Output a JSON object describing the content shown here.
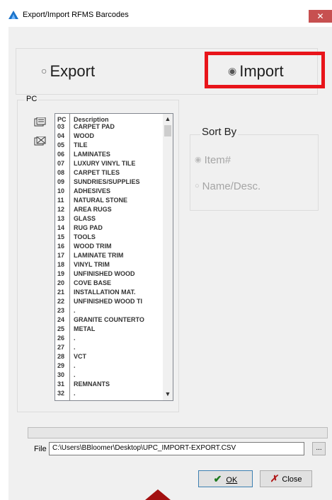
{
  "window": {
    "title": "Export/Import RFMS Barcodes",
    "close_glyph": "✕"
  },
  "mode": {
    "export_label": "Export",
    "import_label": "Import",
    "selected": "Import"
  },
  "pc_group": {
    "label": "PC",
    "header_code": "PC",
    "header_desc": "Description",
    "rows": [
      {
        "code": "03",
        "desc": "CARPET PAD"
      },
      {
        "code": "04",
        "desc": "WOOD"
      },
      {
        "code": "05",
        "desc": "TILE"
      },
      {
        "code": "06",
        "desc": "LAMINATES"
      },
      {
        "code": "07",
        "desc": "LUXURY VINYL TILE"
      },
      {
        "code": "08",
        "desc": "CARPET TILES"
      },
      {
        "code": "09",
        "desc": "SUNDRIES/SUPPLIES"
      },
      {
        "code": "10",
        "desc": "ADHESIVES"
      },
      {
        "code": "11",
        "desc": "NATURAL STONE"
      },
      {
        "code": "12",
        "desc": "AREA RUGS"
      },
      {
        "code": "13",
        "desc": "GLASS"
      },
      {
        "code": "14",
        "desc": "RUG PAD"
      },
      {
        "code": "15",
        "desc": "TOOLS"
      },
      {
        "code": "16",
        "desc": "WOOD TRIM"
      },
      {
        "code": "17",
        "desc": "LAMINATE TRIM"
      },
      {
        "code": "18",
        "desc": "VINYL TRIM"
      },
      {
        "code": "19",
        "desc": "UNFINISHED WOOD"
      },
      {
        "code": "20",
        "desc": "COVE BASE"
      },
      {
        "code": "21",
        "desc": "INSTALLATION MAT."
      },
      {
        "code": "22",
        "desc": "UNFINISHED WOOD TI"
      },
      {
        "code": "23",
        "desc": "."
      },
      {
        "code": "24",
        "desc": "GRANITE COUNTERTO"
      },
      {
        "code": "25",
        "desc": "METAL"
      },
      {
        "code": "26",
        "desc": "."
      },
      {
        "code": "27",
        "desc": "."
      },
      {
        "code": "28",
        "desc": "VCT"
      },
      {
        "code": "29",
        "desc": "."
      },
      {
        "code": "30",
        "desc": "."
      },
      {
        "code": "31",
        "desc": "REMNANTS"
      },
      {
        "code": "32",
        "desc": "."
      }
    ],
    "scroll_up": "▲",
    "scroll_down": "▼"
  },
  "sort_by": {
    "title": "Sort By",
    "option_item": "Item#",
    "option_name": "Name/Desc.",
    "selected": "Item#"
  },
  "file": {
    "label": "File",
    "path": "C:\\Users\\BBloomer\\Desktop\\UPC_IMPORT-EXPORT.CSV",
    "browse_label": "..."
  },
  "buttons": {
    "ok_label": "OK",
    "close_label": "Close"
  },
  "colors": {
    "highlight": "#e8141a",
    "title_accent": "#1a73c9"
  }
}
